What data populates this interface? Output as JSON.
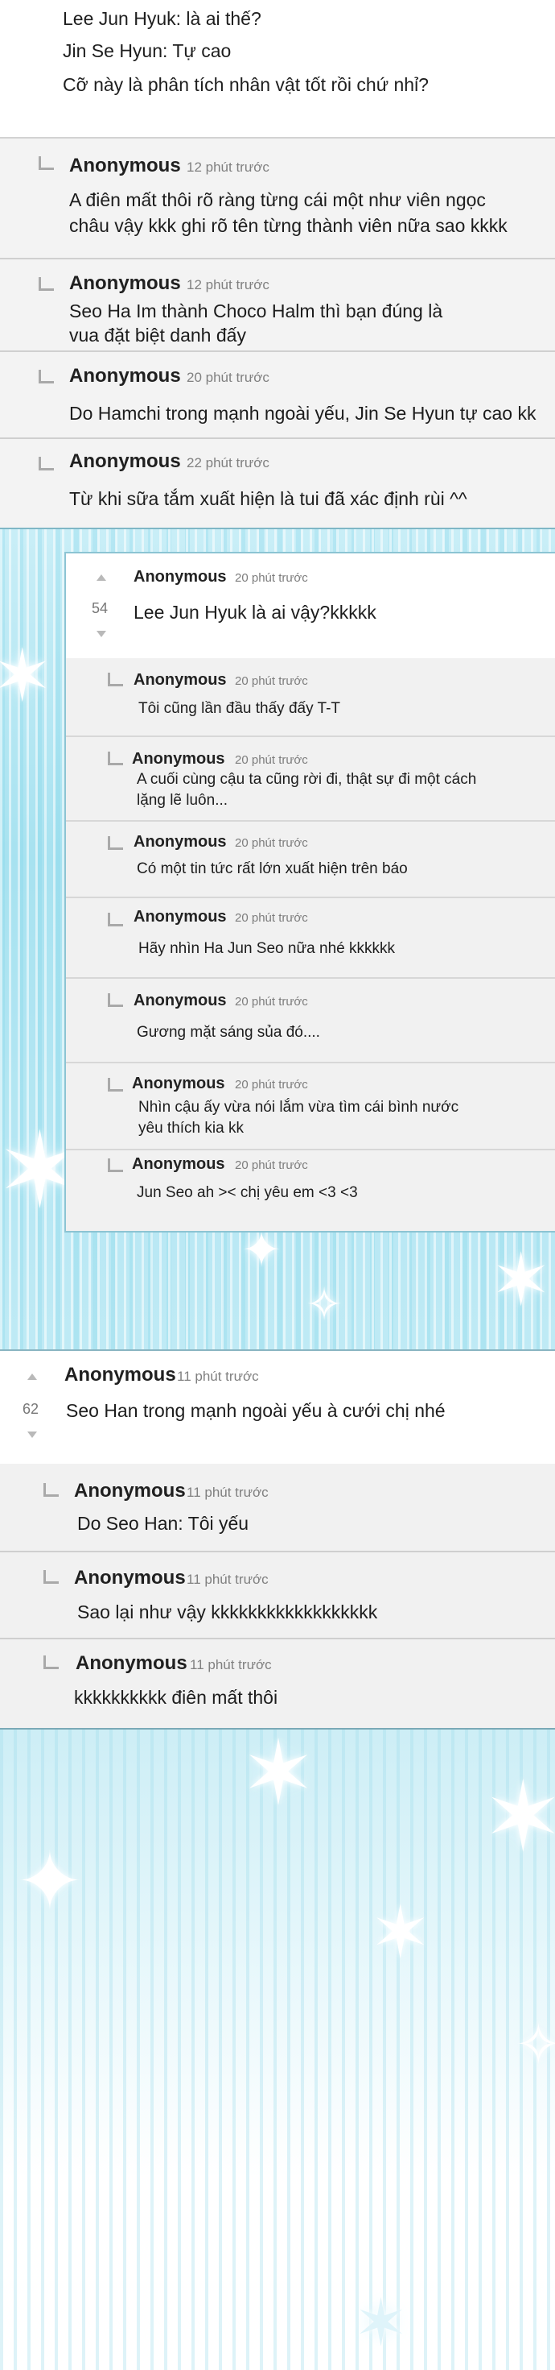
{
  "top": {
    "lines": [
      "Lee Jun Hyuk: là ai thế?",
      "Jin Se Hyun: Tự cao",
      "Cỡ này là phân tích nhân vật tốt rồi chứ nhỉ?"
    ]
  },
  "gray_comments": [
    {
      "author": "Anonymous",
      "time": "12 phút trước",
      "text": [
        "A điên mất thôi rõ ràng từng cái một như viên ngọc",
        "châu vậy kkk ghi rõ tên từng thành viên nữa sao kkkk"
      ]
    },
    {
      "author": "Anonymous",
      "time": "12 phút trước",
      "text": [
        "Seo Ha Im thành Choco Halm thì bạn đúng là",
        "vua đặt biệt danh đấy"
      ]
    },
    {
      "author": "Anonymous",
      "time": "20 phút trước",
      "text": [
        "Do Hamchi trong mạnh ngoài yếu, Jin Se Hyun tự cao kk"
      ]
    },
    {
      "author": "Anonymous",
      "time": "22 phút trước",
      "text": [
        "Từ khi sữa tắm xuất hiện là tui đã xác định rùi ^^"
      ]
    }
  ],
  "panel": {
    "main": {
      "author": "Anonymous",
      "time": "20 phút trước",
      "votes": "54",
      "text": "Lee Jun Hyuk là ai vậy?kkkkk"
    },
    "replies": [
      {
        "author": "Anonymous",
        "time": "20 phút trước",
        "text": [
          "Tôi cũng lần đầu thấy đấy T-T"
        ]
      },
      {
        "author": "Anonymous",
        "time": "20 phút trước",
        "text": [
          "A cuối cùng cậu ta cũng rời đi, thật sự đi một cách",
          "lặng lẽ luôn..."
        ]
      },
      {
        "author": "Anonymous",
        "time": "20 phút trước",
        "text": [
          "Có một tin tức rất lớn xuất hiện trên báo"
        ]
      },
      {
        "author": "Anonymous",
        "time": "20 phút trước",
        "text": [
          "Hãy nhìn Ha Jun Seo nữa nhé kkkkkk"
        ]
      },
      {
        "author": "Anonymous",
        "time": "20 phút trước",
        "text": [
          "Gương mặt sáng sủa đó...."
        ]
      },
      {
        "author": "Anonymous",
        "time": "20 phút trước",
        "text": [
          "Nhìn cậu ấy vừa nói lắm vừa tìm cái bình nước",
          "yêu thích kia kk"
        ]
      },
      {
        "author": "Anonymous",
        "time": "20 phút trước",
        "text": [
          "Jun Seo ah >< chị yêu em <3 <3"
        ]
      }
    ]
  },
  "thread2": {
    "main": {
      "author": "Anonymous",
      "time": "11 phút trước",
      "votes": "62",
      "text": "Seo Han trong mạnh ngoài yếu à cưới chị nhé"
    },
    "replies": [
      {
        "author": "Anonymous",
        "time": "11 phút trước",
        "text": "Do Seo Han: Tôi yếu"
      },
      {
        "author": "Anonymous",
        "time": "11 phút trước",
        "text": "Sao lại như vậy kkkkkkkkkkkkkkkkkk"
      },
      {
        "author": "Anonymous",
        "time": "11 phút trước",
        "text": "kkkkkkkkkk điên mất thôi"
      }
    ]
  }
}
